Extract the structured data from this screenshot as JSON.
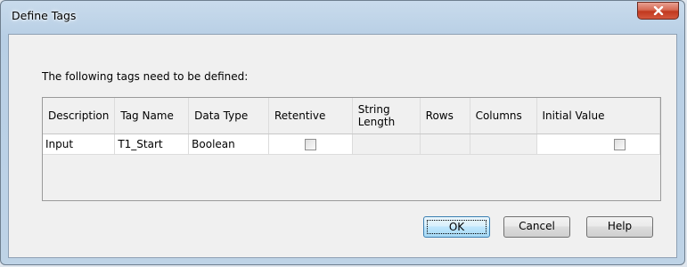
{
  "window": {
    "title": "Define Tags"
  },
  "prompt": "The following tags need to be defined:",
  "table": {
    "columns": [
      "Description",
      "Tag Name",
      "Data Type",
      "Retentive",
      "String Length",
      "Rows",
      "Columns",
      "Initial Value"
    ],
    "rows": [
      {
        "description": "Input",
        "tag_name": "T1_Start",
        "data_type": "Boolean",
        "retentive": false,
        "string_length": "",
        "rows": "",
        "columns": "",
        "initial_value": false
      }
    ]
  },
  "buttons": {
    "ok": "OK",
    "cancel": "Cancel",
    "help": "Help"
  },
  "icons": {
    "close": "close-icon",
    "checkbox": "checkbox-icon"
  },
  "colors": {
    "close_button": "#c1391f",
    "titlebar": "#b8cfe5",
    "client_background": "#f0f0f0"
  }
}
